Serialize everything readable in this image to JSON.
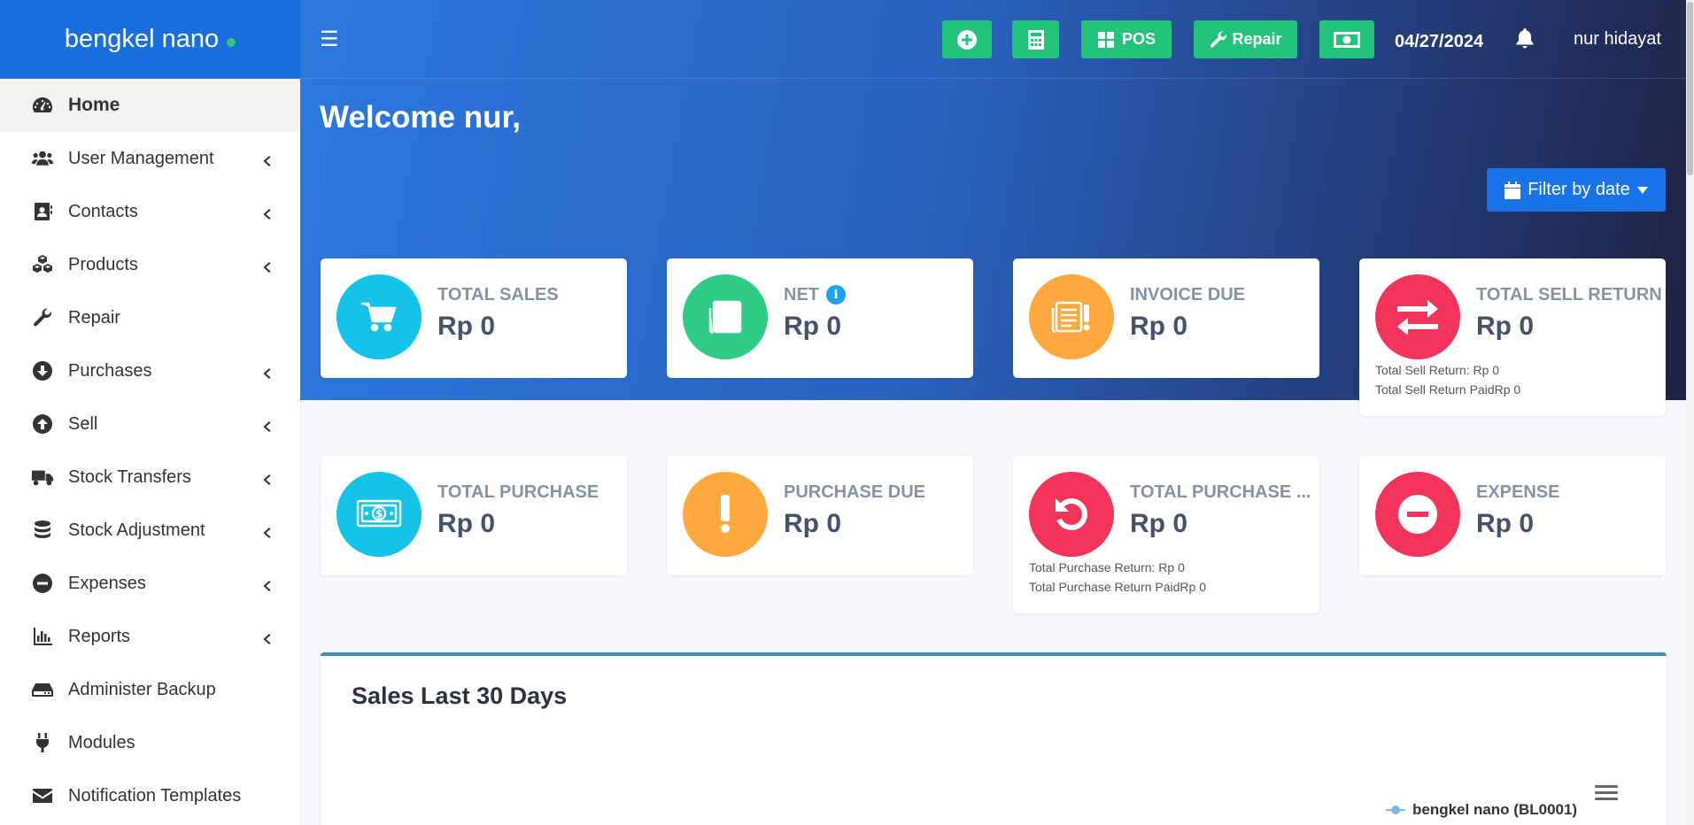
{
  "brand": {
    "name": "bengkel nano",
    "status_color": "#2ecc71",
    "bg": "#1a6fe0"
  },
  "sidebar": {
    "items": [
      {
        "label": "Home",
        "icon": "dashboard-icon",
        "has_children": false,
        "active": true
      },
      {
        "label": "User Management",
        "icon": "users-icon",
        "has_children": true
      },
      {
        "label": "Contacts",
        "icon": "address-book-icon",
        "has_children": true
      },
      {
        "label": "Products",
        "icon": "cubes-icon",
        "has_children": true
      },
      {
        "label": "Repair",
        "icon": "wrench-icon",
        "has_children": false
      },
      {
        "label": "Purchases",
        "icon": "arrow-circle-down-icon",
        "has_children": true
      },
      {
        "label": "Sell",
        "icon": "arrow-circle-up-icon",
        "has_children": true
      },
      {
        "label": "Stock Transfers",
        "icon": "truck-icon",
        "has_children": true
      },
      {
        "label": "Stock Adjustment",
        "icon": "database-icon",
        "has_children": true
      },
      {
        "label": "Expenses",
        "icon": "minus-circle-icon",
        "has_children": true
      },
      {
        "label": "Reports",
        "icon": "bar-chart-icon",
        "has_children": true
      },
      {
        "label": "Administer Backup",
        "icon": "hdd-icon",
        "has_children": false
      },
      {
        "label": "Modules",
        "icon": "plug-icon",
        "has_children": false
      },
      {
        "label": "Notification Templates",
        "icon": "envelope-icon",
        "has_children": false
      }
    ]
  },
  "header": {
    "menu_icon": "hamburger-icon",
    "pos_label": "POS",
    "repair_label": "Repair",
    "date": "04/27/2024",
    "user_name": "nur hidayat",
    "button_color": "#22c37a"
  },
  "main": {
    "welcome": "Welcome nur,",
    "filter_label": "Filter by date",
    "cards": [
      {
        "title": "TOTAL SALES",
        "value": "Rp 0",
        "icon": "cart-icon",
        "color": "#13c4e8"
      },
      {
        "title": "NET",
        "value": "Rp 0",
        "icon": "file-lines-icon",
        "color": "#2ecc85",
        "info": "i"
      },
      {
        "title": "INVOICE DUE",
        "value": "Rp 0",
        "icon": "invoice-warning-icon",
        "color": "#ffa83d"
      },
      {
        "title": "TOTAL SELL RETURN",
        "value": "Rp 0",
        "icon": "exchange-icon",
        "color": "#f2335a",
        "sub": [
          "Total Sell Return: Rp 0",
          "Total Sell Return PaidRp 0"
        ]
      },
      {
        "title": "TOTAL PURCHASE",
        "value": "Rp 0",
        "icon": "money-bill-icon",
        "color": "#13c4e8"
      },
      {
        "title": "PURCHASE DUE",
        "value": "Rp 0",
        "icon": "exclamation-icon",
        "color": "#ffa83d"
      },
      {
        "title": "TOTAL PURCHASE ...",
        "value": "Rp 0",
        "icon": "undo-icon",
        "color": "#f2335a",
        "sub": [
          "Total Purchase Return: Rp 0",
          "Total Purchase Return PaidRp 0"
        ]
      },
      {
        "title": "EXPENSE",
        "value": "Rp 0",
        "icon": "minus-circle-icon",
        "color": "#f2335a"
      }
    ],
    "chart": {
      "title": "Sales Last 30 Days",
      "legend": "bengkel nano (BL0001)",
      "series_color": "#7cb5ec"
    }
  }
}
